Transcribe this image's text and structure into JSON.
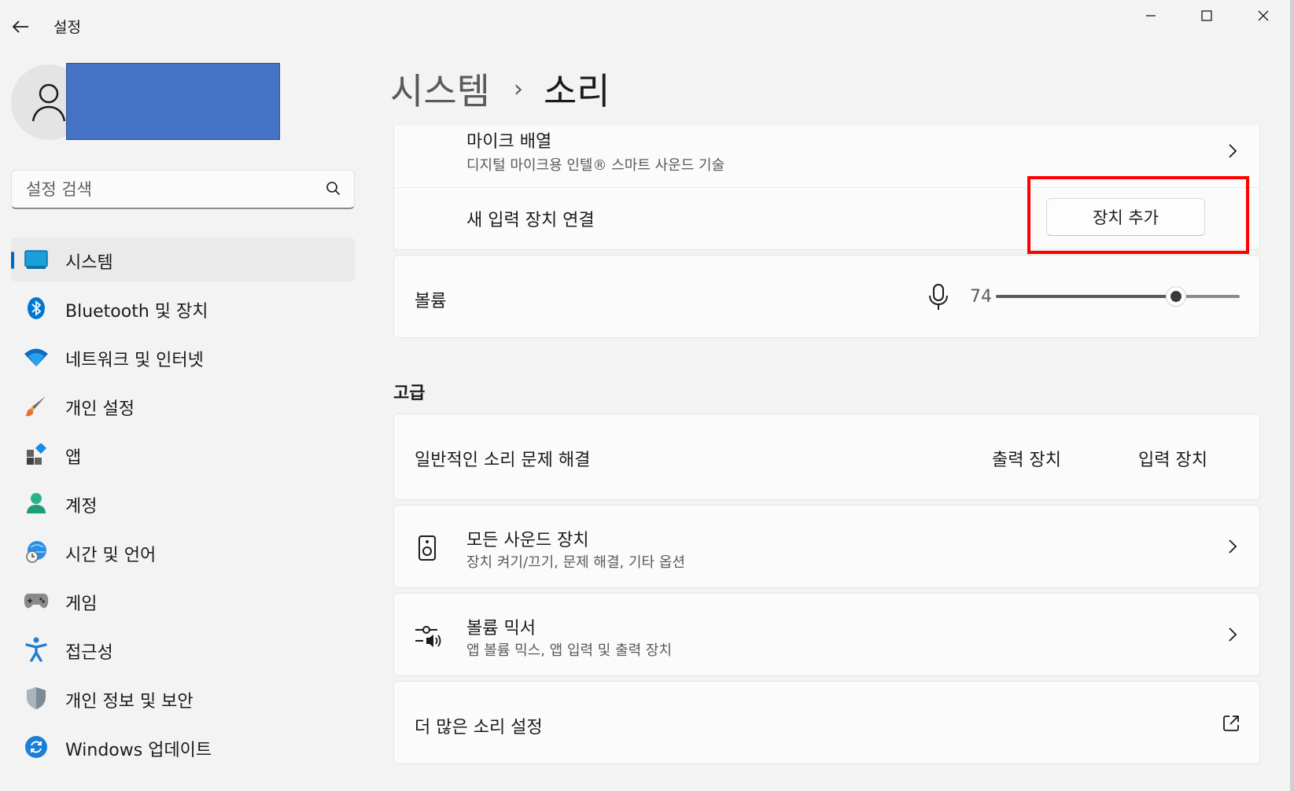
{
  "window": {
    "title": "설정",
    "controls": {
      "minimize": "minimize",
      "maximize": "maximize",
      "close": "close"
    }
  },
  "sidebar": {
    "search_placeholder": "설정 검색",
    "items": [
      {
        "label": "시스템",
        "icon": "system-icon",
        "active": true
      },
      {
        "label": "Bluetooth 및 장치",
        "icon": "bluetooth-icon"
      },
      {
        "label": "네트워크 및 인터넷",
        "icon": "wifi-icon"
      },
      {
        "label": "개인 설정",
        "icon": "brush-icon"
      },
      {
        "label": "앱",
        "icon": "apps-icon"
      },
      {
        "label": "계정",
        "icon": "account-icon"
      },
      {
        "label": "시간 및 언어",
        "icon": "time-language-icon"
      },
      {
        "label": "게임",
        "icon": "gamepad-icon"
      },
      {
        "label": "접근성",
        "icon": "accessibility-icon"
      },
      {
        "label": "개인 정보 및 보안",
        "icon": "shield-icon"
      },
      {
        "label": "Windows 업데이트",
        "icon": "update-icon"
      }
    ]
  },
  "header": {
    "parent": "시스템",
    "separator": "›",
    "current": "소리"
  },
  "input_section": {
    "mic_array": {
      "title": "마이크 배열",
      "subtitle": "디지털 마이크용 인텔® 스마트 사운드 기술"
    },
    "connect_new": {
      "label": "새 입력 장치 연결",
      "button": "장치 추가"
    }
  },
  "volume": {
    "label": "볼륨",
    "value": "74",
    "level": 0.74
  },
  "advanced": {
    "heading": "고급",
    "troubleshoot": {
      "label": "일반적인 소리 문제 해결",
      "output_link": "출력 장치",
      "input_link": "입력 장치"
    },
    "all_devices": {
      "title": "모든 사운드 장치",
      "subtitle": "장치 켜기/끄기, 문제 해결, 기타 옵션"
    },
    "mixer": {
      "title": "볼륨 믹서",
      "subtitle": "앱 볼륨 믹스, 앱 입력 및 출력 장치"
    },
    "more_settings": {
      "label": "더 많은 소리 설정"
    }
  },
  "colors": {
    "accent": "#0067c0",
    "highlight_box": "#ff0000",
    "user_redaction": "#4472c4"
  }
}
